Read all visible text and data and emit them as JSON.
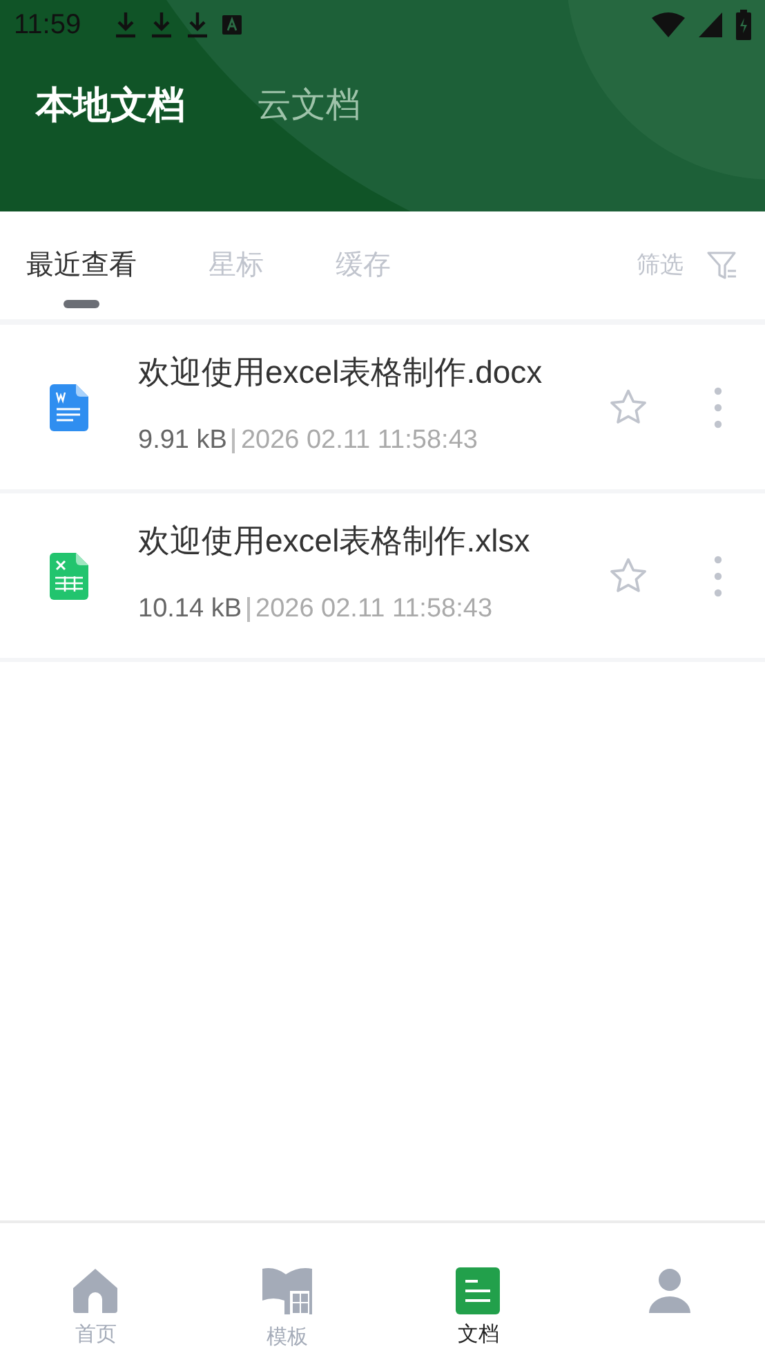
{
  "status_bar": {
    "time": "11:59"
  },
  "header_tabs": [
    {
      "label": "本地文档",
      "selected": true
    },
    {
      "label": "云文档",
      "selected": false
    }
  ],
  "filter_tabs": [
    {
      "label": "最近查看",
      "selected": true
    },
    {
      "label": "星标",
      "selected": false
    },
    {
      "label": "缓存",
      "selected": false
    }
  ],
  "filter": {
    "label": "筛选"
  },
  "files": [
    {
      "kind": "word",
      "name": "欢迎使用excel表格制作.docx",
      "size": "9.91 kB",
      "date": "2026 02.11 11:58:43",
      "starred": false
    },
    {
      "kind": "excel",
      "name": "欢迎使用excel表格制作.xlsx",
      "size": "10.14 kB",
      "date": "2026 02.11 11:58:43",
      "starred": false
    }
  ],
  "bottom_nav": [
    {
      "kind": "home",
      "label": "首页",
      "selected": false
    },
    {
      "kind": "template",
      "label": "模板",
      "selected": false
    },
    {
      "kind": "docs",
      "label": "文档",
      "selected": true
    },
    {
      "kind": "profile",
      "selected": false
    }
  ]
}
